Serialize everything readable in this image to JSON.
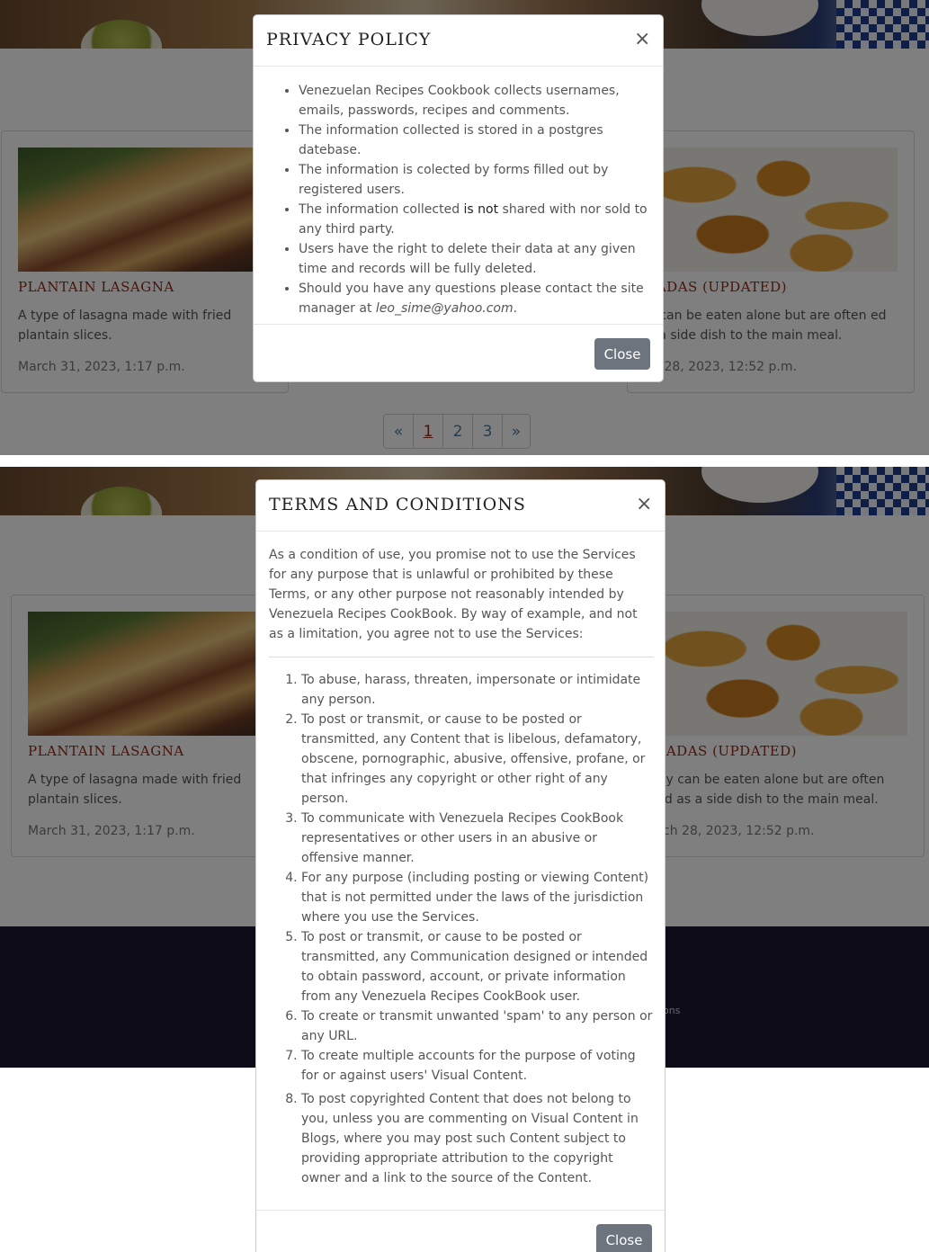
{
  "cards": {
    "left": {
      "title": "PLANTAIN LASAGNA",
      "description": "A type of lasagna made with fried plantain slices.",
      "date": "March 31, 2023, 1:17 p.m."
    },
    "right": {
      "title": "AJADAS (UPDATED)",
      "description": "ey can be eaten alone but are often ed as a side dish to the main meal.",
      "date": "rch 28, 2023, 12:52 p.m."
    },
    "right_bottom": {
      "title": "AJADAS (UPDATED)",
      "description": "hey can be eaten alone but are often sed as a side dish to the main meal.",
      "date": "arch 28, 2023, 12:52 p.m."
    }
  },
  "pagination": {
    "prev": "«",
    "pages": [
      "1",
      "2",
      "3"
    ],
    "next": "»",
    "current": "1"
  },
  "footer": {
    "partial_link": "ons"
  },
  "privacy_modal": {
    "title": "PRIVACY POLICY",
    "close_x": "×",
    "items": [
      {
        "text": "Venezuelan Recipes Cookbook collects usernames, emails, passwords, recipes and comments."
      },
      {
        "text": "The information collected is stored in a postgres datebase."
      },
      {
        "text": "The information is colected by forms filled out by registered users."
      },
      {
        "pre": "The information collected ",
        "strong": "is not",
        "post": " shared with nor sold to any third party."
      },
      {
        "text": "Users have the right to delete their data at any given time and records will be fully deleted."
      },
      {
        "pre": "Should you have any questions please contact the site manager at ",
        "email": "leo_sime@yahoo.com",
        "post": "."
      }
    ],
    "close_button": "Close"
  },
  "terms_modal": {
    "title": "TERMS AND CONDITIONS",
    "close_x": "×",
    "intro": "As a condition of use, you promise not to use the Services for any purpose that is unlawful or prohibited by these Terms, or any other purpose not reasonably intended by Venezuela Recipes CookBook. By way of example, and not as a limitation, you agree not to use the Services:",
    "items": [
      "To abuse, harass, threaten, impersonate or intimidate any person.",
      "To post or transmit, or cause to be posted or transmitted, any Content that is libelous, defamatory, obscene, pornographic, abusive, offensive, profane, or that infringes any copyright or other right of any person.",
      "To communicate with Venezuela Recipes CookBook representatives or other users in an abusive or offensive manner.",
      "For any purpose (including posting or viewing Content) that is not permitted under the laws of the jurisdiction where you use the Services.",
      "To post or transmit, or cause to be posted or transmitted, any Communication designed or intended to obtain password, account, or private information from any Venezuela Recipes CookBook user.",
      "To create or transmit unwanted 'spam' to any person or any URL.",
      "To create multiple accounts for the purpose of voting for or against users' Visual Content.",
      "To post copyrighted Content that does not belong to you, unless you are commenting on Visual Content in Blogs, where you may post such Content subject to providing appropriate attribution to the copyright owner and a link to the source of the Content."
    ],
    "close_button": "Close"
  }
}
